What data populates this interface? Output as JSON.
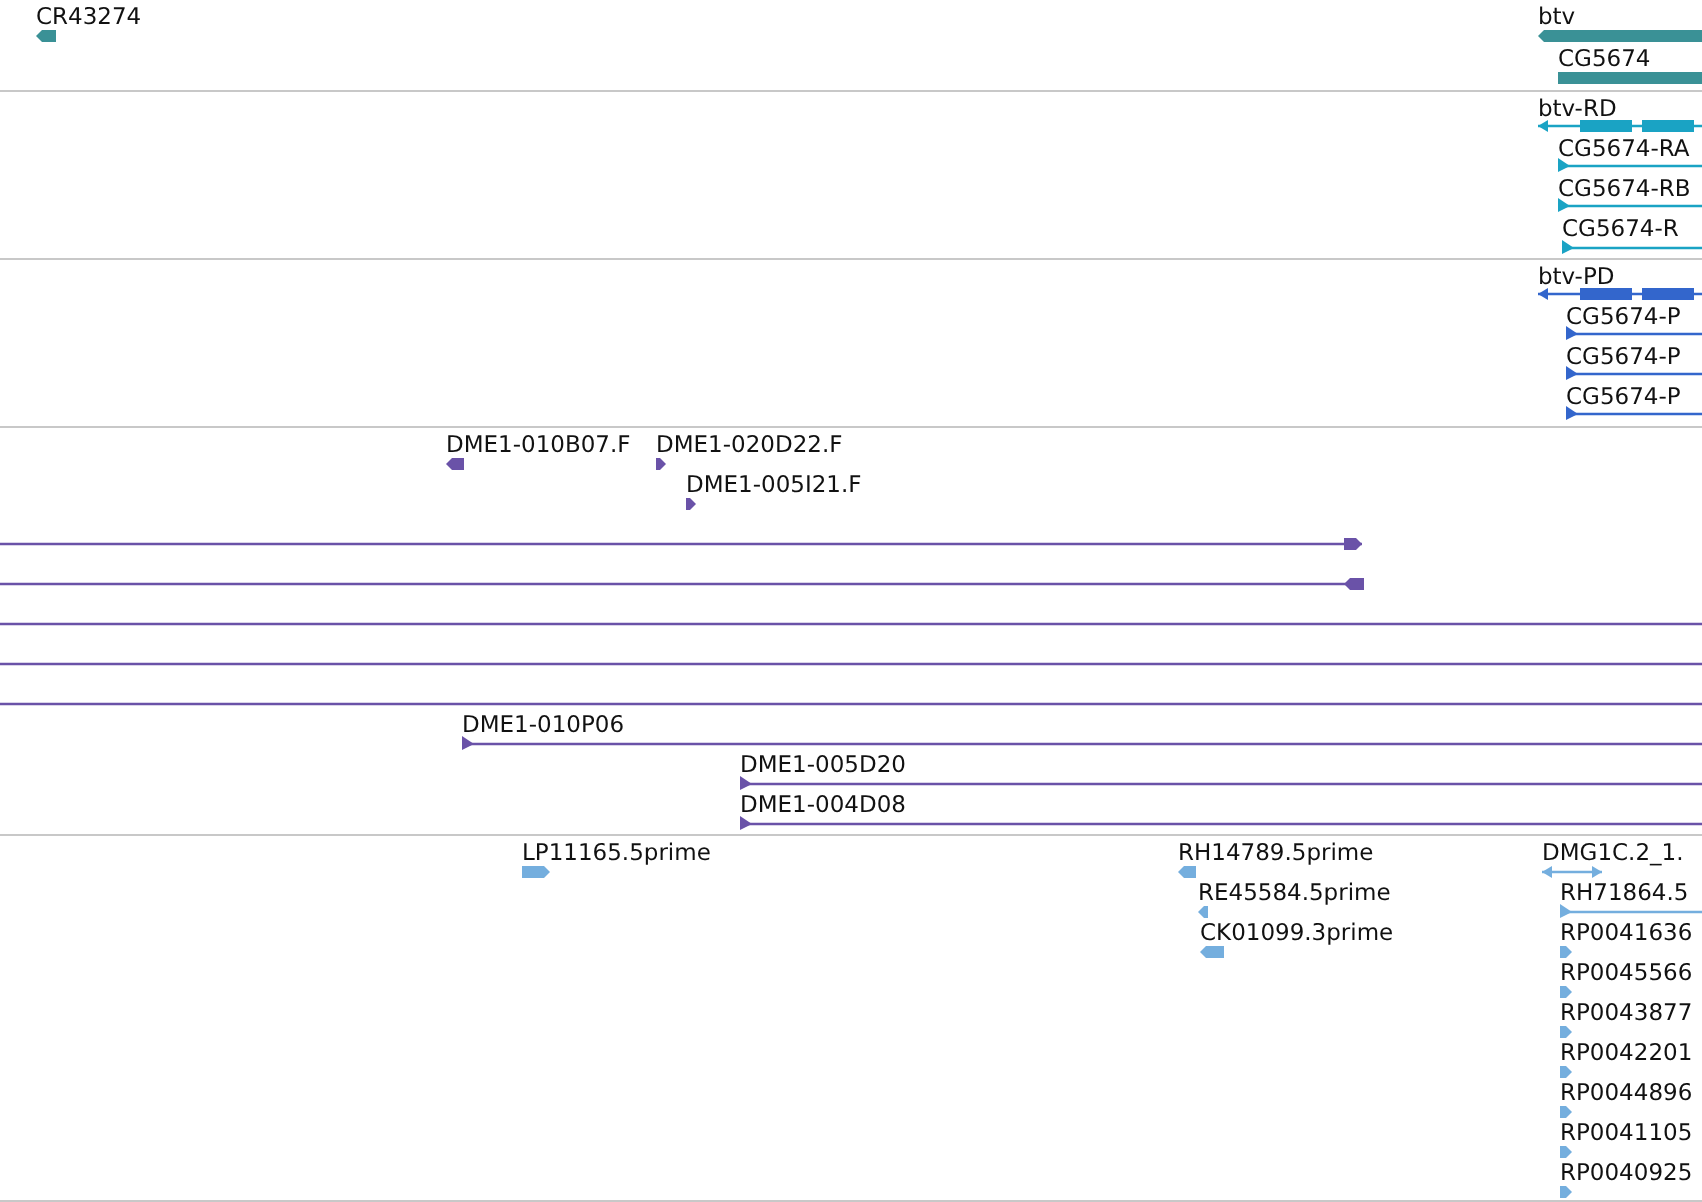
{
  "tracks": [
    {
      "color": "#3a9196",
      "features": [
        {
          "label": "CR43274",
          "kind": "arrowbar",
          "forward": false
        },
        {
          "label": "btv",
          "kind": "arrowbar",
          "forward": false
        },
        {
          "label": "CG5674",
          "kind": "bar"
        }
      ]
    },
    {
      "color": "#1aa3c4",
      "features": [
        {
          "label": "btv-RD",
          "kind": "model",
          "forward": false
        },
        {
          "label": "CG5674-RA",
          "kind": "arrowline",
          "forward": true
        },
        {
          "label": "CG5674-RB",
          "kind": "arrowline",
          "forward": true
        },
        {
          "label": "CG5674-R",
          "kind": "arrowline",
          "forward": true
        }
      ]
    },
    {
      "color": "#3366cc",
      "features": [
        {
          "label": "btv-PD",
          "kind": "model",
          "forward": false
        },
        {
          "label": "CG5674-P",
          "kind": "arrowline",
          "forward": true
        },
        {
          "label": "CG5674-P",
          "kind": "arrowline",
          "forward": true
        },
        {
          "label": "CG5674-P",
          "kind": "arrowline",
          "forward": true
        }
      ]
    },
    {
      "color": "#6a52a8",
      "features": [
        {
          "label": "DME1-010B07.F",
          "kind": "arrowbar",
          "forward": false
        },
        {
          "label": "DME1-020D22.F",
          "kind": "arrowbar",
          "forward": true
        },
        {
          "label": "DME1-005I21.F",
          "kind": "arrowbar",
          "forward": true
        },
        {
          "kind": "arrowline",
          "forward": true
        },
        {
          "kind": "arrowline",
          "forward": false
        },
        {
          "kind": "line"
        },
        {
          "kind": "line"
        },
        {
          "kind": "line"
        },
        {
          "label": "DME1-010P06",
          "kind": "arrowline",
          "forward": true
        },
        {
          "label": "DME1-005D20",
          "kind": "arrowline",
          "forward": true
        },
        {
          "label": "DME1-004D08",
          "kind": "arrowline",
          "forward": true
        }
      ]
    },
    {
      "color": "#74aede",
      "features": [
        {
          "label": "LP11165.5prime",
          "kind": "arrowbar",
          "forward": true
        },
        {
          "label": "RH14789.5prime",
          "kind": "arrowbar",
          "forward": false
        },
        {
          "label": "RE45584.5prime",
          "kind": "arrowbar",
          "forward": false
        },
        {
          "label": "CK01099.3prime",
          "kind": "arrowbar",
          "forward": false
        },
        {
          "label": "DMG1C.2_1.",
          "kind": "doubleline"
        },
        {
          "label": "RH71864.5",
          "kind": "arrowline",
          "forward": true
        },
        {
          "label": "RP0041636",
          "kind": "arrowbar",
          "forward": true
        },
        {
          "label": "RP0045566",
          "kind": "arrowbar",
          "forward": true
        },
        {
          "label": "RP0043877",
          "kind": "arrowbar",
          "forward": true
        },
        {
          "label": "RP0042201",
          "kind": "arrowbar",
          "forward": true
        },
        {
          "label": "RP0044896",
          "kind": "arrowbar",
          "forward": true
        },
        {
          "label": "RP0041105",
          "kind": "arrowbar",
          "forward": true
        },
        {
          "label": "RP0040925",
          "kind": "arrowbar",
          "forward": true
        }
      ]
    }
  ]
}
